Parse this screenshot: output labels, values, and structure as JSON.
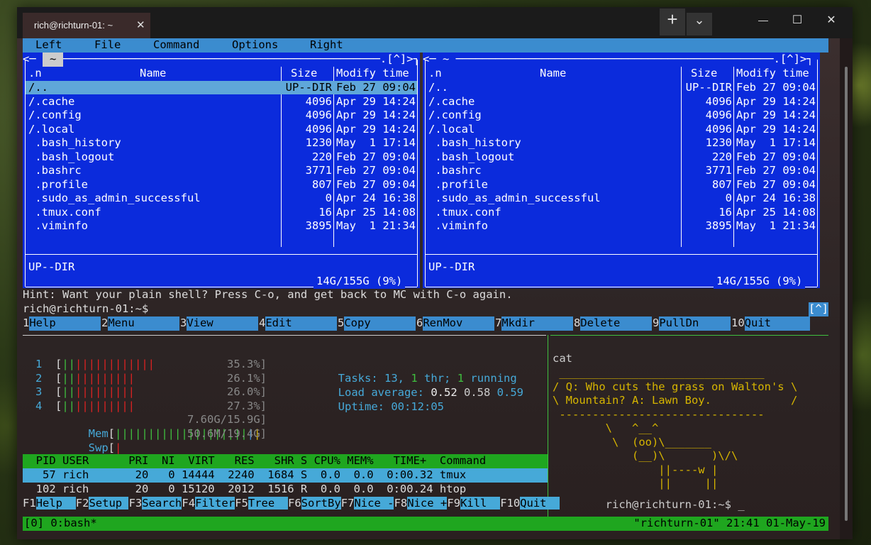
{
  "window": {
    "tab_title": "rich@richturn-01: ~",
    "close_tab": "✕",
    "new_tab": "+",
    "dropdown": "⌄",
    "minimize": "—",
    "maximize": "☐",
    "close": "✕"
  },
  "mc": {
    "menu": [
      "Left",
      "File",
      "Command",
      "Options",
      "Right"
    ],
    "left_header": "<─ ~ ─────────────────────────────────────────────────.[^]>┐",
    "right_header": "<─ ~ ────────────────────────────────────────────────.[^]>┐",
    "columns": {
      "name": "Name",
      "n": ".n",
      "size": "Size",
      "mtime": "Modify time"
    },
    "files": [
      {
        "name": "/..",
        "size": "UP--DIR",
        "mtime": "Feb 27 09:04"
      },
      {
        "name": "/.cache",
        "size": "4096",
        "mtime": "Apr 29 14:24"
      },
      {
        "name": "/.config",
        "size": "4096",
        "mtime": "Apr 29 14:24"
      },
      {
        "name": "/.local",
        "size": "4096",
        "mtime": "Apr 29 14:24"
      },
      {
        "name": " .bash_history",
        "size": "1230",
        "mtime": "May  1 17:14"
      },
      {
        "name": " .bash_logout",
        "size": "220",
        "mtime": "Feb 27 09:04"
      },
      {
        "name": " .bashrc",
        "size": "3771",
        "mtime": "Feb 27 09:04"
      },
      {
        "name": " .profile",
        "size": "807",
        "mtime": "Feb 27 09:04"
      },
      {
        "name": " .sudo_as_admin_successful",
        "size": "0",
        "mtime": "Apr 24 16:38"
      },
      {
        "name": " .tmux.conf",
        "size": "16",
        "mtime": "Apr 25 14:08"
      },
      {
        "name": " .viminfo",
        "size": "3895",
        "mtime": "May  1 21:34"
      }
    ],
    "status": "UP--DIR",
    "disk": "14G/155G (9%)",
    "hint": "Hint: Want your plain shell? Press C-o, and get back to MC with C-o again.",
    "prompt": "rich@richturn-01:~$",
    "caret": "[^]",
    "fkeys": [
      {
        "n": "1",
        "label": "Help"
      },
      {
        "n": "2",
        "label": "Menu"
      },
      {
        "n": "3",
        "label": "View"
      },
      {
        "n": "4",
        "label": "Edit"
      },
      {
        "n": "5",
        "label": "Copy"
      },
      {
        "n": "6",
        "label": "RenMov"
      },
      {
        "n": "7",
        "label": "Mkdir"
      },
      {
        "n": "8",
        "label": "Delete"
      },
      {
        "n": "9",
        "label": "PullDn"
      },
      {
        "n": "10",
        "label": "Quit"
      }
    ]
  },
  "htop": {
    "cpus": [
      {
        "id": "1",
        "bars": "||||||||||||",
        "pct": "35.3%]"
      },
      {
        "id": "2",
        "bars": "|||||||||",
        "pct": "26.1%]"
      },
      {
        "id": "3",
        "bars": "|||||||||",
        "pct": "26.0%]"
      },
      {
        "id": "4",
        "bars": "|||||||||",
        "pct": "27.3%]"
      }
    ],
    "mem": {
      "label": "Mem",
      "bars": "||||||||||||||||||||",
      "value": "7.60G/15.9G]"
    },
    "swp": {
      "label": "Swp",
      "value": "50.6M/19.4G]"
    },
    "tasks_label": "Tasks:",
    "tasks": "13,",
    "thr": "1",
    "thr_label": "thr;",
    "running": "1",
    "running_label": "running",
    "load_label": "Load average:",
    "load1": "0.52",
    "load5": "0.58",
    "load15": "0.59",
    "uptime_label": "Uptime:",
    "uptime": "00:12:05",
    "header": "  PID USER      PRI  NI  VIRT   RES   SHR S CPU% MEM%   TIME+  Command",
    "procs": [
      "   57 rich       20   0 14444  2240  1684 S  0.0  0.0  0:00.32 tmux",
      "  102 rich       20   0 15120  2012  1516 R  0.0  0.0  0:00.24 htop"
    ],
    "fkeys": [
      {
        "n": "F1",
        "label": "Help  "
      },
      {
        "n": "F2",
        "label": "Setup "
      },
      {
        "n": "F3",
        "label": "Search"
      },
      {
        "n": "F4",
        "label": "Filter"
      },
      {
        "n": "F5",
        "label": "Tree  "
      },
      {
        "n": "F6",
        "label": "SortBy"
      },
      {
        "n": "F7",
        "label": "Nice -"
      },
      {
        "n": "F8",
        "label": "Nice +"
      },
      {
        "n": "F9",
        "label": "Kill  "
      },
      {
        "n": "F10",
        "label": "Quit  "
      }
    ]
  },
  "cow": {
    "cmd": "cat",
    "lines": [
      " _______________________________",
      "/ Q: Who cuts the grass on Walton's \\",
      "\\ Mountain? A: Lawn Boy.            /",
      " -------------------------------",
      "        \\   ^__^",
      "         \\  (oo)\\_______",
      "            (__)\\       )\\/\\",
      "                ||----w |",
      "                ||     ||"
    ],
    "prompt": "rich@richturn-01:~$"
  },
  "tmux": {
    "left": "[0] 0:bash*",
    "right": "\"richturn-01\" 21:41 01-May-19"
  }
}
